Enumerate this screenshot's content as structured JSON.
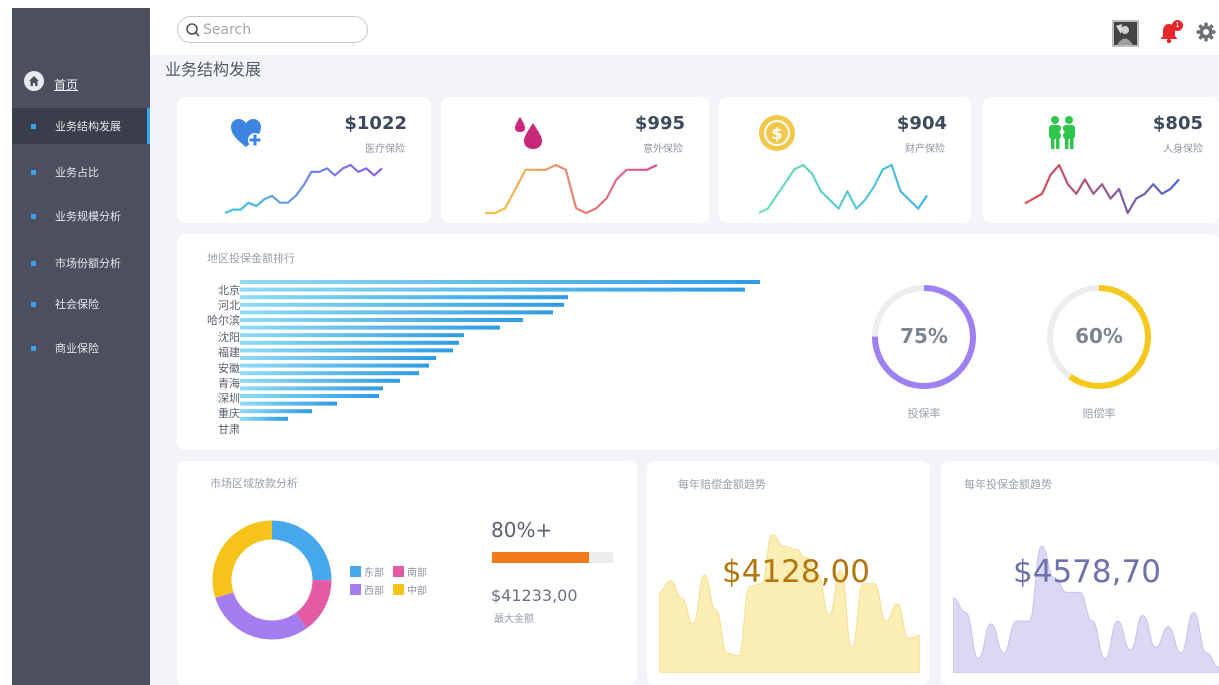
{
  "sidebar": {
    "home_label": "首页",
    "items": [
      {
        "label": "业务结构发展",
        "active": true
      },
      {
        "label": "业务占比"
      },
      {
        "label": "业务规模分析"
      },
      {
        "label": "市场份额分析"
      },
      {
        "label": "社会保险"
      },
      {
        "label": "商业保险"
      }
    ]
  },
  "topbar": {
    "search_placeholder": "Search",
    "notification_count": "1"
  },
  "page_title": "业务结构发展",
  "kpis": [
    {
      "amount": "$1022",
      "label": "医疗保险",
      "icon": "heart-plus-icon",
      "color": "#3d85e0",
      "trend": [
        2,
        3,
        3,
        5,
        4,
        6,
        7,
        5,
        5,
        7,
        10,
        14,
        14,
        15,
        13,
        15,
        16,
        14,
        15,
        13,
        15
      ]
    },
    {
      "amount": "$995",
      "label": "意外保险",
      "icon": "drops-icon",
      "color": "#c8277a",
      "trend": [
        5,
        5,
        6,
        10,
        14,
        14,
        14,
        15,
        14,
        6,
        5,
        6,
        8,
        12,
        14,
        14,
        14,
        15
      ]
    },
    {
      "amount": "$904",
      "label": "财产保险",
      "icon": "money-coin-icon",
      "color": "#f3c64c",
      "trend": [
        3,
        4,
        7,
        10,
        13,
        14,
        12,
        8,
        6,
        4,
        8,
        4,
        6,
        9,
        13,
        14,
        8,
        6,
        4,
        7
      ]
    },
    {
      "amount": "$805",
      "label": "人身保险",
      "icon": "family-icon",
      "color": "#2ec64b",
      "trend": [
        6,
        7,
        8,
        12,
        14,
        10,
        8,
        11,
        8,
        10,
        7,
        9,
        4,
        7,
        8,
        10,
        8,
        9,
        11
      ]
    }
  ],
  "regions": {
    "title": "地区投保金额排行",
    "labels": [
      "北京",
      "河北",
      "哈尔滨",
      "沈阳",
      "福建",
      "安徽",
      "青海",
      "深圳",
      "重庆",
      "甘肃"
    ],
    "bars": [
      520,
      505,
      328,
      324,
      313,
      283,
      260,
      224,
      219,
      213,
      196,
      189,
      179,
      160,
      143,
      139,
      97,
      72,
      48
    ]
  },
  "rings": [
    {
      "value": "75%",
      "fraction": 0.75,
      "label": "投保率",
      "color": "#9d80f1"
    },
    {
      "value": "60%",
      "fraction": 0.6,
      "label": "赔偿率",
      "color": "#f5c81b"
    }
  ],
  "market": {
    "title": "市场区域放款分析",
    "segments": [
      {
        "name": "东部",
        "value": 25,
        "color": "#47a7ec"
      },
      {
        "name": "南部",
        "value": 15,
        "color": "#e25ba3"
      },
      {
        "name": "西部",
        "value": 30,
        "color": "#a57df0"
      },
      {
        "name": "中部",
        "value": 30,
        "color": "#f6c31a"
      }
    ],
    "percent": "80%+",
    "progress": 0.8,
    "max_amount": "$41233,00",
    "max_label": "最大金额"
  },
  "claims_trend": {
    "title": "每年赔偿金额趋势",
    "amount": "$4128,00",
    "fill": "#fbeeb5",
    "stroke": "#f3de92",
    "text_color": "#b4770f",
    "values": [
      28,
      32,
      26,
      17,
      34,
      22,
      7,
      6,
      30,
      31,
      48,
      44,
      43,
      40,
      34,
      20,
      36,
      9,
      31,
      31,
      18,
      24,
      12,
      13
    ]
  },
  "insured_trend": {
    "title": "每年投保金额趋势",
    "amount": "$4578,70",
    "fill": "#ddd7f4",
    "stroke": "#c9bff0",
    "text_color": "#6c72ad",
    "values": [
      26,
      21,
      5,
      17,
      7,
      18,
      18,
      44,
      33,
      28,
      28,
      18,
      5,
      18,
      8,
      20,
      9,
      16,
      7,
      21,
      7,
      2
    ]
  }
}
